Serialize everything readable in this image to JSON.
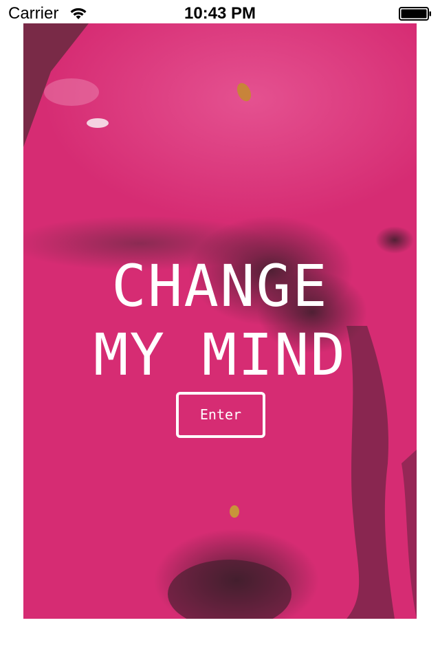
{
  "status_bar": {
    "carrier": "Carrier",
    "time": "10:43 PM",
    "wifi_icon": "wifi-icon",
    "battery_icon": "battery-icon"
  },
  "hero": {
    "background_color": "#d62c73",
    "title_line1": "CHANGE",
    "title_line2": "MY MIND",
    "enter_label": "Enter"
  }
}
